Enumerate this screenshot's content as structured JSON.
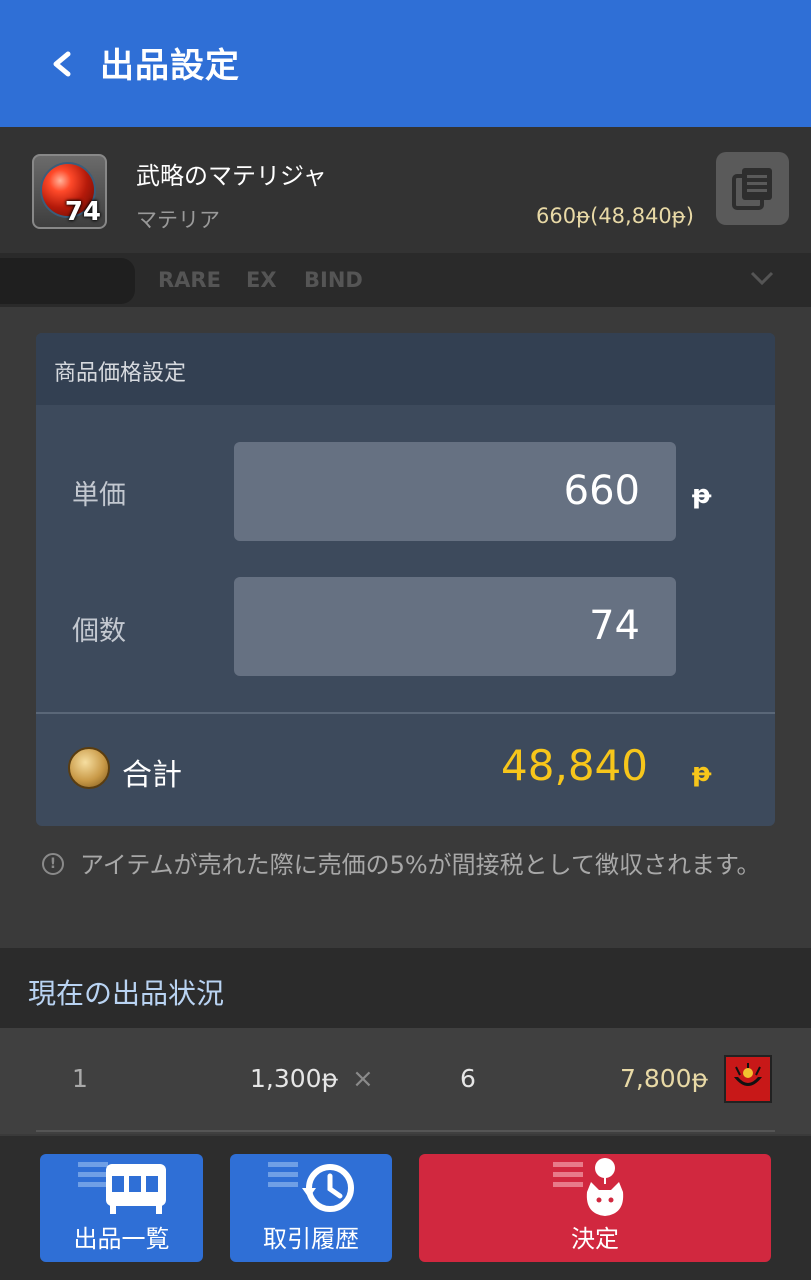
{
  "header": {
    "title": "出品設定",
    "back_icon": "chevron-left-icon"
  },
  "item": {
    "name": "武略のマテリジャ",
    "category": "マテリア",
    "quantity": "74",
    "price_text": "660ᵽ(48,840ᵽ)",
    "icon": "materia-icon"
  },
  "filters": {
    "tags": [
      "RARE",
      "EX",
      "BIND"
    ]
  },
  "price_panel": {
    "title": "商品価格設定",
    "unit_price_label": "単価",
    "unit_price_value": "660",
    "quantity_label": "個数",
    "quantity_value": "74",
    "currency": "ᵽ",
    "total_label": "合計",
    "total_value": "48,840"
  },
  "notice": {
    "text": "アイテムが売れた際に売価の5%が間接税として徴収されます。"
  },
  "current_listings": {
    "title": "現在の出品状況",
    "rows": [
      {
        "index": "1",
        "price": "1,300ᵽ",
        "times": "×",
        "quantity": "6",
        "total": "7,800ᵽ"
      }
    ]
  },
  "bottom_buttons": {
    "listings": "出品一覧",
    "history": "取引履歴",
    "confirm": "決定"
  },
  "colors": {
    "header": "#2f6fd6",
    "total_accent": "#f7c61b",
    "confirm_button": "#d1283f",
    "blue_button": "#2f6fd6"
  }
}
